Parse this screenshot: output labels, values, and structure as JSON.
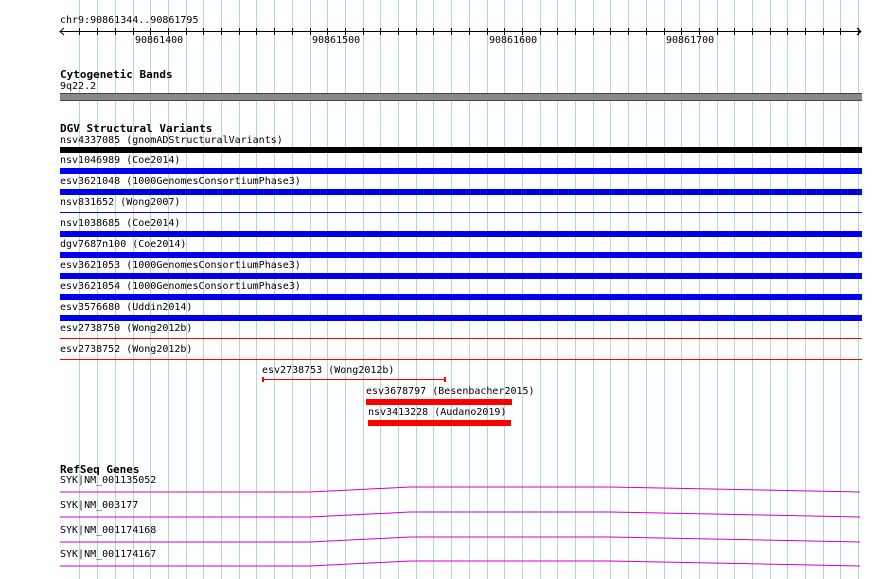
{
  "ruler": {
    "label": "chr9:90861344..90861795",
    "ticks": [
      "90861400",
      "90861500",
      "90861600",
      "90861700"
    ]
  },
  "cytoband": {
    "title": "Cytogenetic Bands",
    "band": "9q22.2"
  },
  "dgv": {
    "title": "DGV Structural Variants",
    "rows": [
      "nsv4337085 (gnomADStructuralVariants)",
      "nsv1046989 (Coe2014)",
      "esv3621048 (1000GenomesConsortiumPhase3)",
      "nsv831652 (Wong2007)",
      "nsv1038685 (Coe2014)",
      "dgv7687n100 (Coe2014)",
      "esv3621053 (1000GenomesConsortiumPhase3)",
      "esv3621054 (1000GenomesConsortiumPhase3)",
      "esv3576680 (Uddin2014)",
      "esv2738750 (Wong2012b)",
      "esv2738752 (Wong2012b)"
    ],
    "partial": [
      "esv2738753 (Wong2012b)",
      "esv3678797 (Besenbacher2015)",
      "nsv3413228 (Audano2019)"
    ]
  },
  "refseq": {
    "title": "RefSeq Genes",
    "rows": [
      "SYK|NM_001135052",
      "SYK|NM_003177",
      "SYK|NM_001174168",
      "SYK|NM_001174167"
    ]
  },
  "colors": {
    "blue": "#0000ee",
    "red": "#ff0000",
    "black": "#000000",
    "band": "#888888",
    "gene": "#cc00cc",
    "grid": "#aed7e6"
  }
}
